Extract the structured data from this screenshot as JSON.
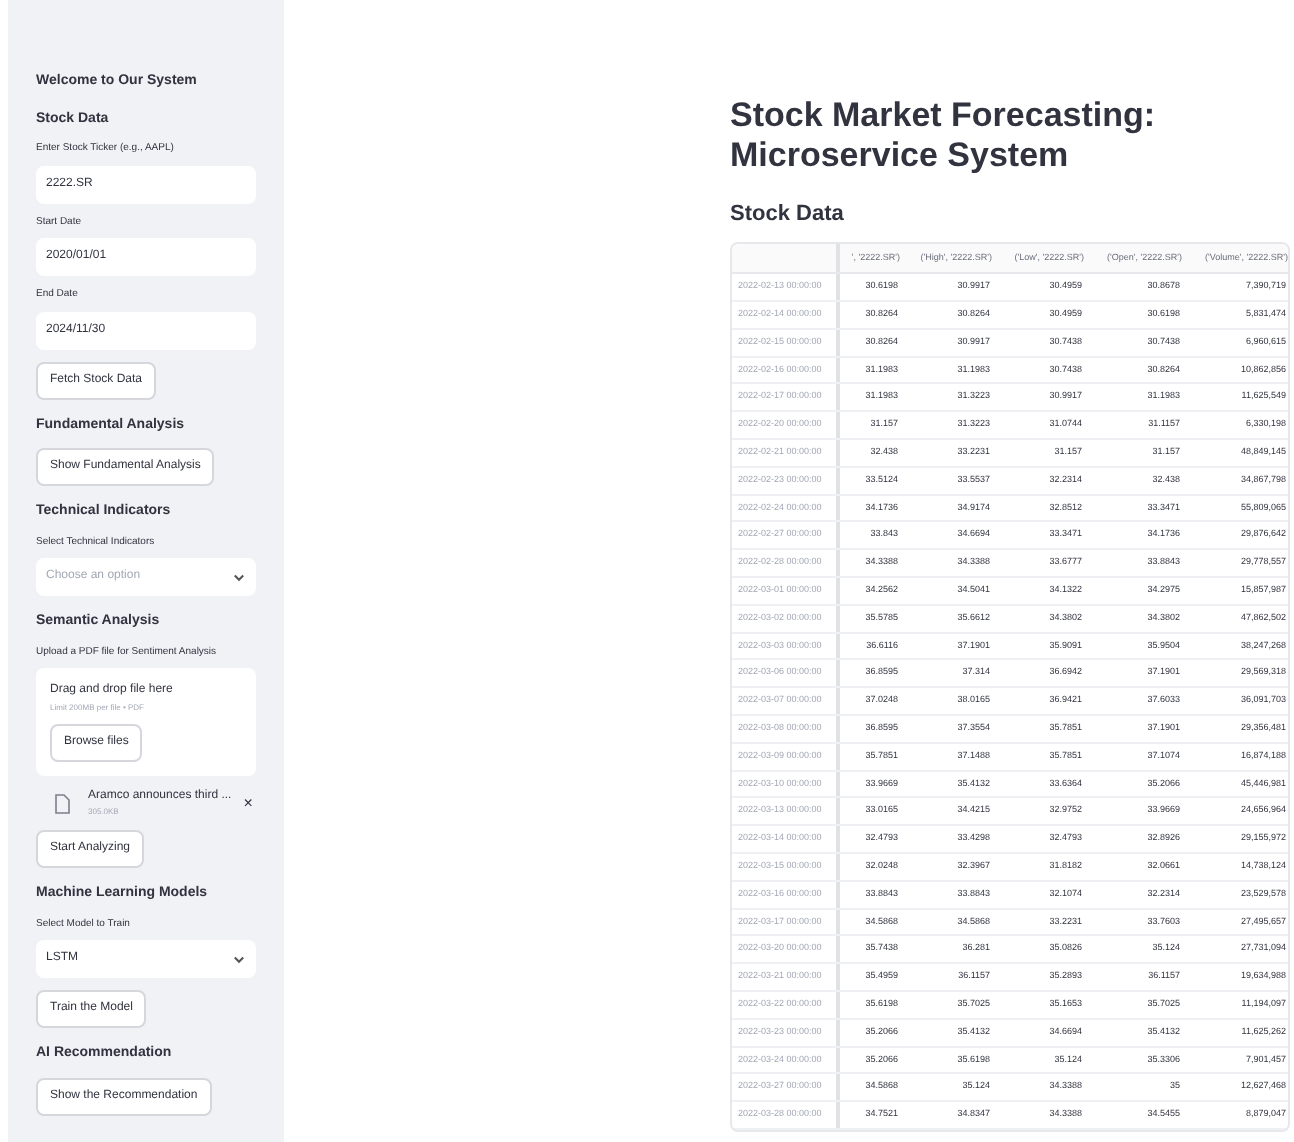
{
  "sidebar": {
    "welcome": "Welcome to Our System",
    "sections": [
      {
        "title": "Stock Data",
        "items": [
          {
            "kind": "input",
            "label": "Enter Stock Ticker (e.g., AAPL)",
            "value": "2222.SR"
          },
          {
            "kind": "input",
            "label": "Start Date",
            "value": "2020/01/01"
          },
          {
            "kind": "input",
            "label": "End Date",
            "value": "2024/11/30"
          },
          {
            "kind": "button",
            "label": "Fetch Stock Data"
          }
        ]
      },
      {
        "title": "Fundamental Analysis",
        "items": [
          {
            "kind": "button",
            "label": "Show Fundamental Analysis"
          }
        ]
      },
      {
        "title": "Technical Indicators",
        "items": [
          {
            "kind": "select",
            "label": "Select Technical Indicators",
            "placeholder": "Choose an option"
          }
        ]
      },
      {
        "title": "Semantic Analysis",
        "items": [
          {
            "kind": "upload",
            "label": "Upload a PDF file for Sentiment Analysis",
            "drop_text": "Drag and drop file here",
            "limit": "Limit 200MB per file • PDF",
            "browse": "Browse files"
          },
          {
            "kind": "file",
            "name": "Aramco announces third ...",
            "size": "305.0KB",
            "close": "×"
          },
          {
            "kind": "button",
            "label": "Start Analyzing"
          }
        ]
      },
      {
        "title": "Machine Learning Models",
        "items": [
          {
            "kind": "select",
            "label": "Select Model to Train",
            "value": "LSTM"
          },
          {
            "kind": "button",
            "label": "Train the Model"
          }
        ]
      },
      {
        "title": "AI Recommendation",
        "items": [
          {
            "kind": "button",
            "label": "Show the Recommendation"
          }
        ]
      }
    ]
  },
  "main": {
    "title": "Stock Market Forecasting: Microservice System",
    "subtitle": "Stock Data",
    "table": {
      "columns": [
        "",
        "', '2222.SR')",
        "('High', '2222.SR')",
        "('Low', '2222.SR')",
        "('Open', '2222.SR')",
        "('Volume', '2222.SR')"
      ],
      "rows": [
        [
          "2022-02-13 00:00:00",
          "30.6198",
          "30.9917",
          "30.4959",
          "30.8678",
          "7,390,719"
        ],
        [
          "2022-02-14 00:00:00",
          "30.8264",
          "30.8264",
          "30.4959",
          "30.6198",
          "5,831,474"
        ],
        [
          "2022-02-15 00:00:00",
          "30.8264",
          "30.9917",
          "30.7438",
          "30.7438",
          "6,960,615"
        ],
        [
          "2022-02-16 00:00:00",
          "31.1983",
          "31.1983",
          "30.7438",
          "30.8264",
          "10,862,856"
        ],
        [
          "2022-02-17 00:00:00",
          "31.1983",
          "31.3223",
          "30.9917",
          "31.1983",
          "11,625,549"
        ],
        [
          "2022-02-20 00:00:00",
          "31.157",
          "31.3223",
          "31.0744",
          "31.1157",
          "6,330,198"
        ],
        [
          "2022-02-21 00:00:00",
          "32.438",
          "33.2231",
          "31.157",
          "31.157",
          "48,849,145"
        ],
        [
          "2022-02-23 00:00:00",
          "33.5124",
          "33.5537",
          "32.2314",
          "32.438",
          "34,867,798"
        ],
        [
          "2022-02-24 00:00:00",
          "34.1736",
          "34.9174",
          "32.8512",
          "33.3471",
          "55,809,065"
        ],
        [
          "2022-02-27 00:00:00",
          "33.843",
          "34.6694",
          "33.3471",
          "34.1736",
          "29,876,642"
        ],
        [
          "2022-02-28 00:00:00",
          "34.3388",
          "34.3388",
          "33.6777",
          "33.8843",
          "29,778,557"
        ],
        [
          "2022-03-01 00:00:00",
          "34.2562",
          "34.5041",
          "34.1322",
          "34.2975",
          "15,857,987"
        ],
        [
          "2022-03-02 00:00:00",
          "35.5785",
          "35.6612",
          "34.3802",
          "34.3802",
          "47,862,502"
        ],
        [
          "2022-03-03 00:00:00",
          "36.6116",
          "37.1901",
          "35.9091",
          "35.9504",
          "38,247,268"
        ],
        [
          "2022-03-06 00:00:00",
          "36.8595",
          "37.314",
          "36.6942",
          "37.1901",
          "29,569,318"
        ],
        [
          "2022-03-07 00:00:00",
          "37.0248",
          "38.0165",
          "36.9421",
          "37.6033",
          "36,091,703"
        ],
        [
          "2022-03-08 00:00:00",
          "36.8595",
          "37.3554",
          "35.7851",
          "37.1901",
          "29,356,481"
        ],
        [
          "2022-03-09 00:00:00",
          "35.7851",
          "37.1488",
          "35.7851",
          "37.1074",
          "16,874,188"
        ],
        [
          "2022-03-10 00:00:00",
          "33.9669",
          "35.4132",
          "33.6364",
          "35.2066",
          "45,446,981"
        ],
        [
          "2022-03-13 00:00:00",
          "33.0165",
          "34.4215",
          "32.9752",
          "33.9669",
          "24,656,964"
        ],
        [
          "2022-03-14 00:00:00",
          "32.4793",
          "33.4298",
          "32.4793",
          "32.8926",
          "29,155,972"
        ],
        [
          "2022-03-15 00:00:00",
          "32.0248",
          "32.3967",
          "31.8182",
          "32.0661",
          "14,738,124"
        ],
        [
          "2022-03-16 00:00:00",
          "33.8843",
          "33.8843",
          "32.1074",
          "32.2314",
          "23,529,578"
        ],
        [
          "2022-03-17 00:00:00",
          "34.5868",
          "34.5868",
          "33.2231",
          "33.7603",
          "27,495,657"
        ],
        [
          "2022-03-20 00:00:00",
          "35.7438",
          "36.281",
          "35.0826",
          "35.124",
          "27,731,094"
        ],
        [
          "2022-03-21 00:00:00",
          "35.4959",
          "36.1157",
          "35.2893",
          "36.1157",
          "19,634,988"
        ],
        [
          "2022-03-22 00:00:00",
          "35.6198",
          "35.7025",
          "35.1653",
          "35.7025",
          "11,194,097"
        ],
        [
          "2022-03-23 00:00:00",
          "35.2066",
          "35.4132",
          "34.6694",
          "35.4132",
          "11,625,262"
        ],
        [
          "2022-03-24 00:00:00",
          "35.2066",
          "35.6198",
          "35.124",
          "35.3306",
          "7,901,457"
        ],
        [
          "2022-03-27 00:00:00",
          "34.5868",
          "35.124",
          "34.3388",
          "35",
          "12,627,468"
        ],
        [
          "2022-03-28 00:00:00",
          "34.7521",
          "34.8347",
          "34.3388",
          "34.5455",
          "8,879,047"
        ]
      ]
    }
  }
}
